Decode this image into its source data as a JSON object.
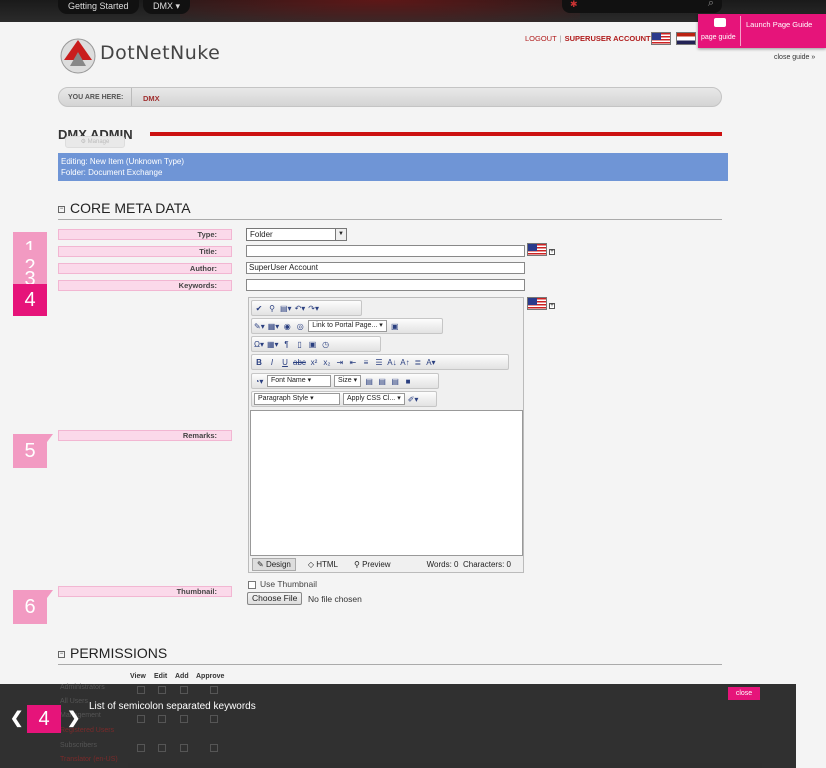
{
  "topbar": {
    "menu_getting_started": "Getting Started",
    "menu_dmx": "DMX ▾"
  },
  "guide": {
    "page_guide_label": "page guide",
    "launch_label": "Launch Page Guide",
    "close_guide": "close guide »"
  },
  "logo": {
    "brand": "DotNetNuke"
  },
  "user": {
    "logout": "LOGOUT",
    "account": "SUPERUSER ACCOUNT"
  },
  "breadcrumb": {
    "label": "YOU ARE HERE:",
    "crumb": "DMX"
  },
  "page": {
    "title": "DMX ADMIN",
    "manage": "⚙ Manage"
  },
  "edit_info": {
    "line1": "Editing: New Item (Unknown Type)",
    "line2": "Folder: Document Exchange"
  },
  "core": {
    "heading": "CORE META DATA",
    "labels": {
      "type": "Type:",
      "title": "Title:",
      "author": "Author:",
      "keywords": "Keywords:",
      "remarks": "Remarks:",
      "thumbnail": "Thumbnail:"
    },
    "type_value": "Folder",
    "author_value": "SuperUser Account",
    "title_value": "",
    "keywords_value": ""
  },
  "steps": [
    "1",
    "2",
    "3",
    "4",
    "5",
    "6"
  ],
  "editor": {
    "link_portal": "Link to Portal Page...",
    "font_name": "Font Name",
    "size": "Size",
    "paragraph_style": "Paragraph Style",
    "apply_css": "Apply CSS Cl...",
    "mode_design": "Design",
    "mode_html": "HTML",
    "mode_preview": "Preview",
    "words": "Words: 0",
    "characters": "Characters: 0"
  },
  "thumbnail": {
    "use_label": "Use Thumbnail",
    "choose_file": "Choose File",
    "no_file": "No file chosen"
  },
  "permissions": {
    "heading": "PERMISSIONS",
    "columns": [
      "View",
      "Edit",
      "Add",
      "Approve"
    ],
    "roles": [
      "Administrators",
      "All Users",
      "Management",
      "Registered Users",
      "Subscribers",
      "Translator (en-US)"
    ]
  },
  "guide_bar": {
    "step": "4",
    "text": "List of semicolon separated keywords",
    "close": "close",
    "prev": "❮",
    "next": "❯"
  }
}
